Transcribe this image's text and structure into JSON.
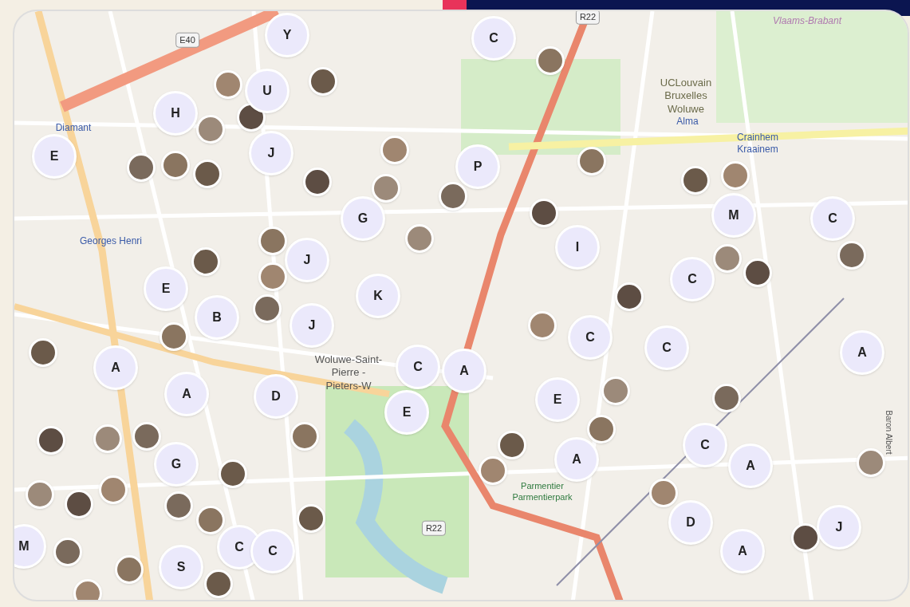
{
  "map": {
    "place_labels": [
      {
        "text": "E40",
        "kind": "road"
      },
      {
        "text": "R22",
        "kind": "road"
      },
      {
        "text": "R22",
        "kind": "road"
      },
      {
        "text": "Vlaams-Brabant",
        "kind": "area"
      },
      {
        "text": "UCLouvain Bruxelles Woluwe",
        "kind": "place"
      },
      {
        "text": "Alma",
        "kind": "station"
      },
      {
        "text": "Crainhem Kraainem",
        "kind": "station"
      },
      {
        "text": "Diamant",
        "kind": "station"
      },
      {
        "text": "Georges Henri",
        "kind": "station"
      },
      {
        "text": "Woluwe-Saint-Pierre - Pieters-W",
        "kind": "district"
      },
      {
        "text": "Parmentier Parmentierpark",
        "kind": "park"
      },
      {
        "text": "Baron Albert",
        "kind": "street"
      }
    ],
    "letter_pins": [
      {
        "label": "Y"
      },
      {
        "label": "C"
      },
      {
        "label": "H"
      },
      {
        "label": "U"
      },
      {
        "label": "E"
      },
      {
        "label": "J"
      },
      {
        "label": "P"
      },
      {
        "label": "G"
      },
      {
        "label": "M"
      },
      {
        "label": "C"
      },
      {
        "label": "I"
      },
      {
        "label": "J"
      },
      {
        "label": "E"
      },
      {
        "label": "C"
      },
      {
        "label": "K"
      },
      {
        "label": "B"
      },
      {
        "label": "J"
      },
      {
        "label": "C"
      },
      {
        "label": "C"
      },
      {
        "label": "A"
      },
      {
        "label": "A"
      },
      {
        "label": "C"
      },
      {
        "label": "A"
      },
      {
        "label": "A"
      },
      {
        "label": "D"
      },
      {
        "label": "E"
      },
      {
        "label": "E"
      },
      {
        "label": "C"
      },
      {
        "label": "A"
      },
      {
        "label": "A"
      },
      {
        "label": "G"
      },
      {
        "label": "D"
      },
      {
        "label": "J"
      },
      {
        "label": "A"
      },
      {
        "label": "C"
      },
      {
        "label": "C"
      },
      {
        "label": "S"
      },
      {
        "label": "M"
      }
    ]
  }
}
